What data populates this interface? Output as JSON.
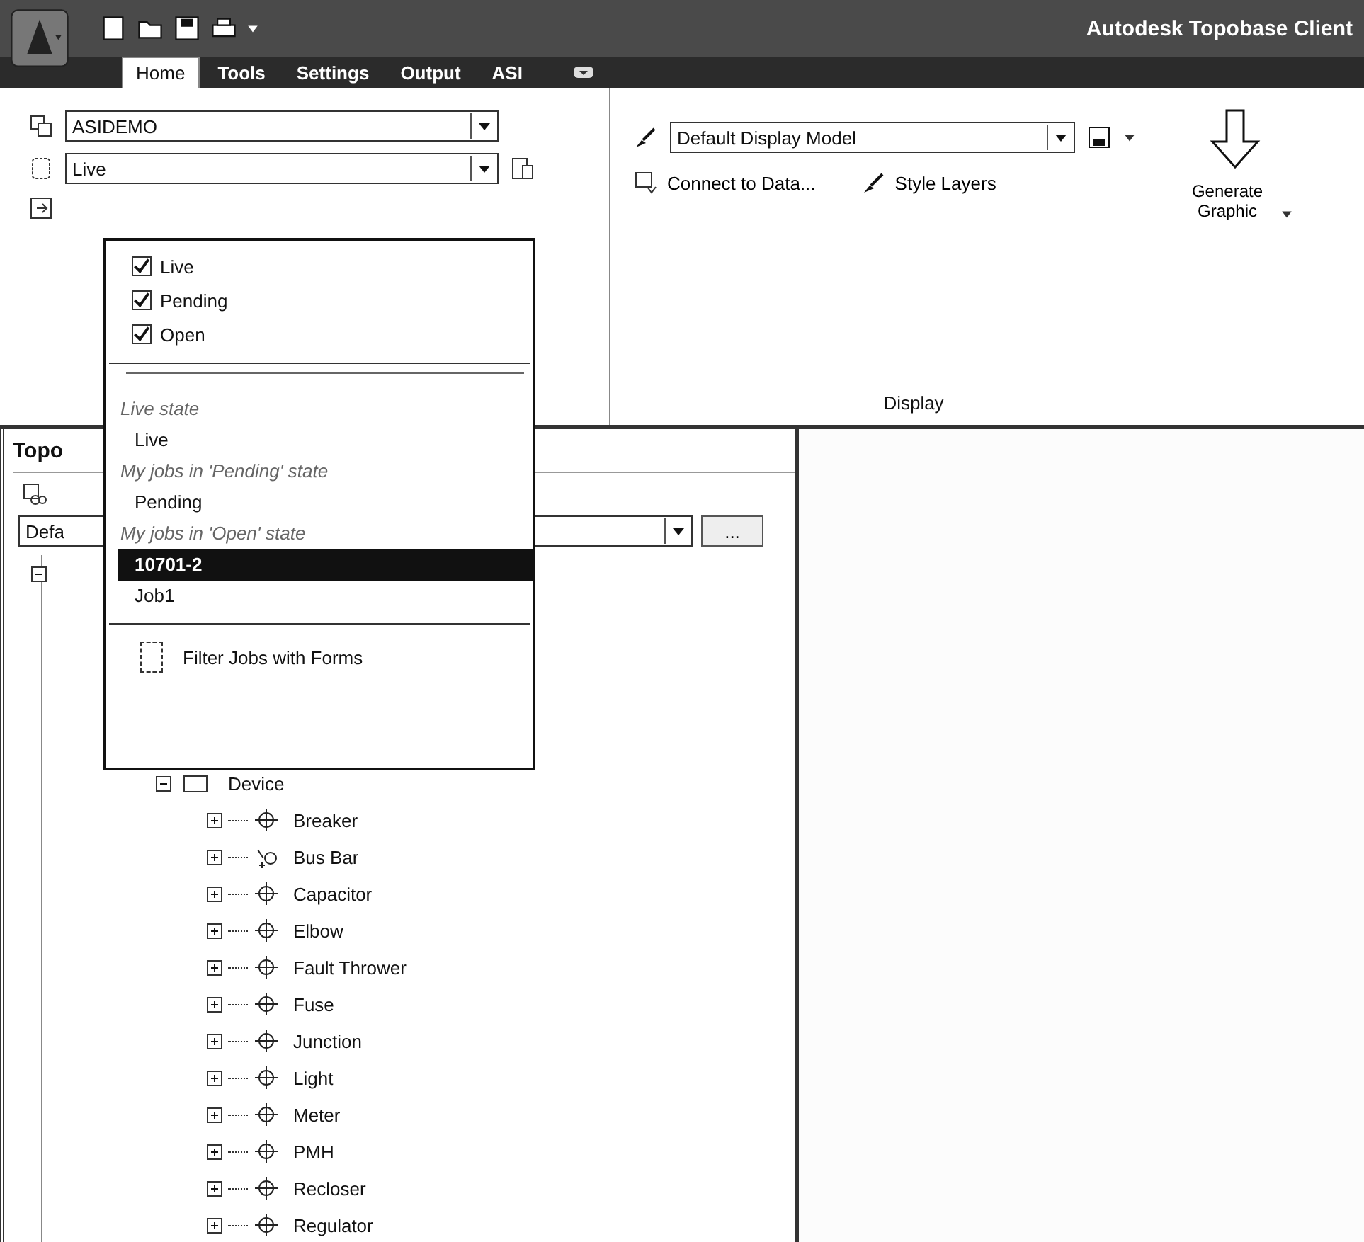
{
  "app_title": "Autodesk Topobase Client",
  "tabs": [
    {
      "label": "Home",
      "selected": true
    },
    {
      "label": "Tools",
      "selected": false
    },
    {
      "label": "Settings",
      "selected": false
    },
    {
      "label": "Output",
      "selected": false
    },
    {
      "label": "ASI",
      "selected": false
    }
  ],
  "ribbon": {
    "workspace_select": {
      "value": "ASIDEMO"
    },
    "state_select": {
      "value": "Live"
    },
    "display": {
      "model_select": {
        "value": "Default Display Model"
      },
      "connect_button": "Connect to Data...",
      "style_layers_button": "Style Layers",
      "generate_button": "Generate Graphic",
      "panel_label": "Display"
    }
  },
  "state_dropdown": {
    "filters": [
      {
        "label": "Live",
        "checked": true
      },
      {
        "label": "Pending",
        "checked": true
      },
      {
        "label": "Open",
        "checked": true
      }
    ],
    "items": [
      {
        "kind": "header",
        "label": "Live state"
      },
      {
        "kind": "option",
        "label": "Live",
        "selected": false
      },
      {
        "kind": "header",
        "label": "My jobs in 'Pending' state"
      },
      {
        "kind": "option",
        "label": "Pending",
        "selected": false
      },
      {
        "kind": "header",
        "label": "My jobs in 'Open' state"
      },
      {
        "kind": "option",
        "label": "10701-2",
        "selected": true
      },
      {
        "kind": "option",
        "label": "Job1",
        "selected": false
      }
    ],
    "filter_forms": {
      "label": "Filter Jobs with Forms",
      "checked": false
    }
  },
  "explorer": {
    "title": "Topo",
    "template_select": {
      "value": "Defa"
    },
    "browse_button": "...",
    "tree": [
      {
        "expanded": true,
        "children": [
          {
            "label": "Device",
            "expanded": true,
            "children": [
              {
                "label": "Breaker",
                "kind": "point",
                "expanded": false
              },
              {
                "label": "Bus Bar",
                "kind": "line",
                "expanded": false
              },
              {
                "label": "Capacitor",
                "kind": "point",
                "expanded": false
              },
              {
                "label": "Elbow",
                "kind": "point",
                "expanded": false
              },
              {
                "label": "Fault Thrower",
                "kind": "point",
                "expanded": false
              },
              {
                "label": "Fuse",
                "kind": "point",
                "expanded": false
              },
              {
                "label": "Junction",
                "kind": "point",
                "expanded": false
              },
              {
                "label": "Light",
                "kind": "point",
                "expanded": false
              },
              {
                "label": "Meter",
                "kind": "point",
                "expanded": false
              },
              {
                "label": "PMH",
                "kind": "point",
                "expanded": false
              },
              {
                "label": "Recloser",
                "kind": "point",
                "expanded": false
              },
              {
                "label": "Regulator",
                "kind": "point",
                "expanded": false
              }
            ]
          }
        ]
      }
    ]
  }
}
